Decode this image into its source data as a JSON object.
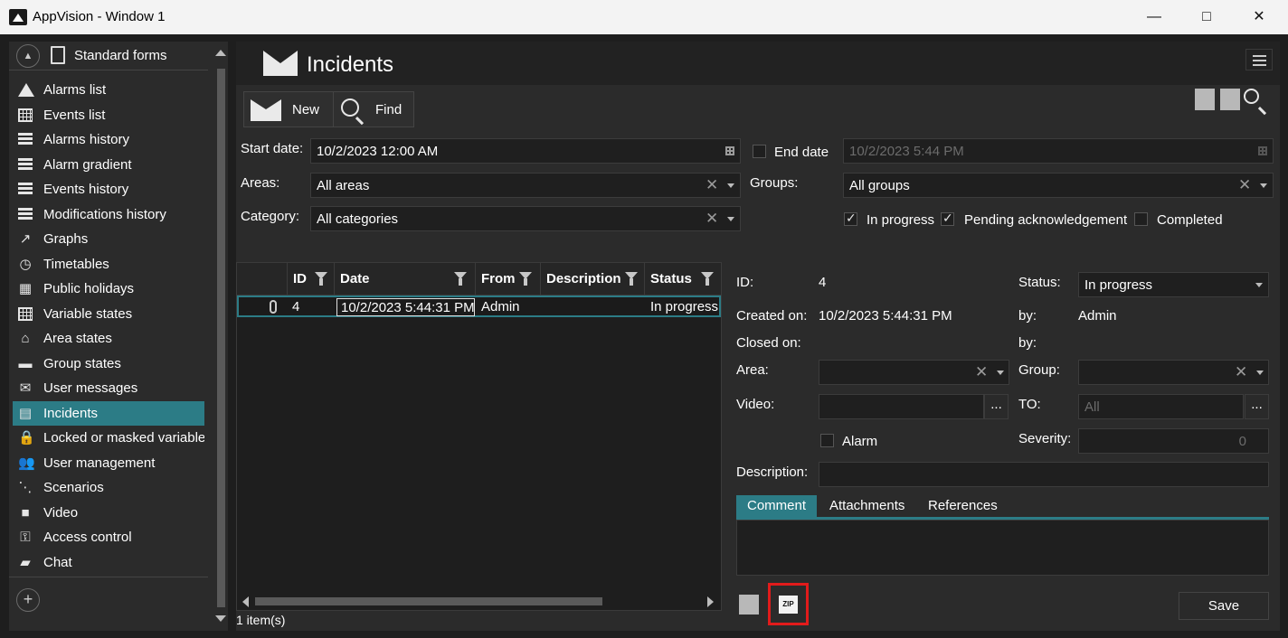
{
  "window": {
    "title": "AppVision - Window 1"
  },
  "sidebar": {
    "header": "Standard forms",
    "items": [
      {
        "label": "Alarms list",
        "icon": "warning-icon"
      },
      {
        "label": "Events list",
        "icon": "grid-icon"
      },
      {
        "label": "Alarms history",
        "icon": "list-icon"
      },
      {
        "label": "Alarm gradient",
        "icon": "list-icon"
      },
      {
        "label": "Events history",
        "icon": "list-icon"
      },
      {
        "label": "Modifications history",
        "icon": "list-icon"
      },
      {
        "label": "Graphs",
        "icon": "graph-icon"
      },
      {
        "label": "Timetables",
        "icon": "clock-icon"
      },
      {
        "label": "Public holidays",
        "icon": "calendar-icon"
      },
      {
        "label": "Variable states",
        "icon": "grid-icon"
      },
      {
        "label": "Area states",
        "icon": "home-icon"
      },
      {
        "label": "Group states",
        "icon": "folder-icon"
      },
      {
        "label": "User messages",
        "icon": "envelope-icon"
      },
      {
        "label": "Incidents",
        "icon": "incident-icon"
      },
      {
        "label": "Locked or masked variable",
        "icon": "lock-icon"
      },
      {
        "label": "User management",
        "icon": "users-icon"
      },
      {
        "label": "Scenarios",
        "icon": "scenario-icon"
      },
      {
        "label": "Video",
        "icon": "video-icon"
      },
      {
        "label": "Access control",
        "icon": "key-icon"
      },
      {
        "label": "Chat",
        "icon": "chat-icon"
      }
    ],
    "active_index": 13
  },
  "main": {
    "title": "Incidents",
    "toolbar": {
      "new_label": "New",
      "find_label": "Find"
    },
    "filters": {
      "start_date_label": "Start date:",
      "start_date_value": "10/2/2023 12:00 AM",
      "end_date_label": "End date",
      "end_date_value": "10/2/2023 5:44 PM",
      "areas_label": "Areas:",
      "areas_value": "All areas",
      "groups_label": "Groups:",
      "groups_value": "All groups",
      "category_label": "Category:",
      "category_value": "All categories",
      "in_progress_label": "In progress",
      "pending_label": "Pending acknowledgement",
      "completed_label": "Completed",
      "in_progress_checked": true,
      "pending_checked": true,
      "completed_checked": false,
      "end_date_checked": false
    },
    "grid": {
      "columns": [
        "ID",
        "Date",
        "From",
        "Description",
        "Status"
      ],
      "rows": [
        {
          "id": "4",
          "date": "10/2/2023 5:44:31 PM",
          "from": "Admin",
          "description": "",
          "status": "In progress"
        }
      ],
      "count_text": "1 item(s)"
    },
    "detail": {
      "id_label": "ID:",
      "id_value": "4",
      "status_label": "Status:",
      "status_value": "In progress",
      "created_on_label": "Created on:",
      "created_on_value": "10/2/2023 5:44:31 PM",
      "by_label": "by:",
      "by_value": "Admin",
      "closed_on_label": "Closed on:",
      "by2_label": "by:",
      "area_label": "Area:",
      "group_label": "Group:",
      "video_label": "Video:",
      "to_label": "TO:",
      "to_value": "All",
      "alarm_label": "Alarm",
      "severity_label": "Severity:",
      "severity_value": "0",
      "description_label": "Description:",
      "tabs": [
        "Comment",
        "Attachments",
        "References"
      ],
      "dots": "...",
      "zip_text": "ZIP",
      "save_label": "Save"
    }
  },
  "colors": {
    "accent": "#2c7c86",
    "highlight": "#e21b1b"
  }
}
